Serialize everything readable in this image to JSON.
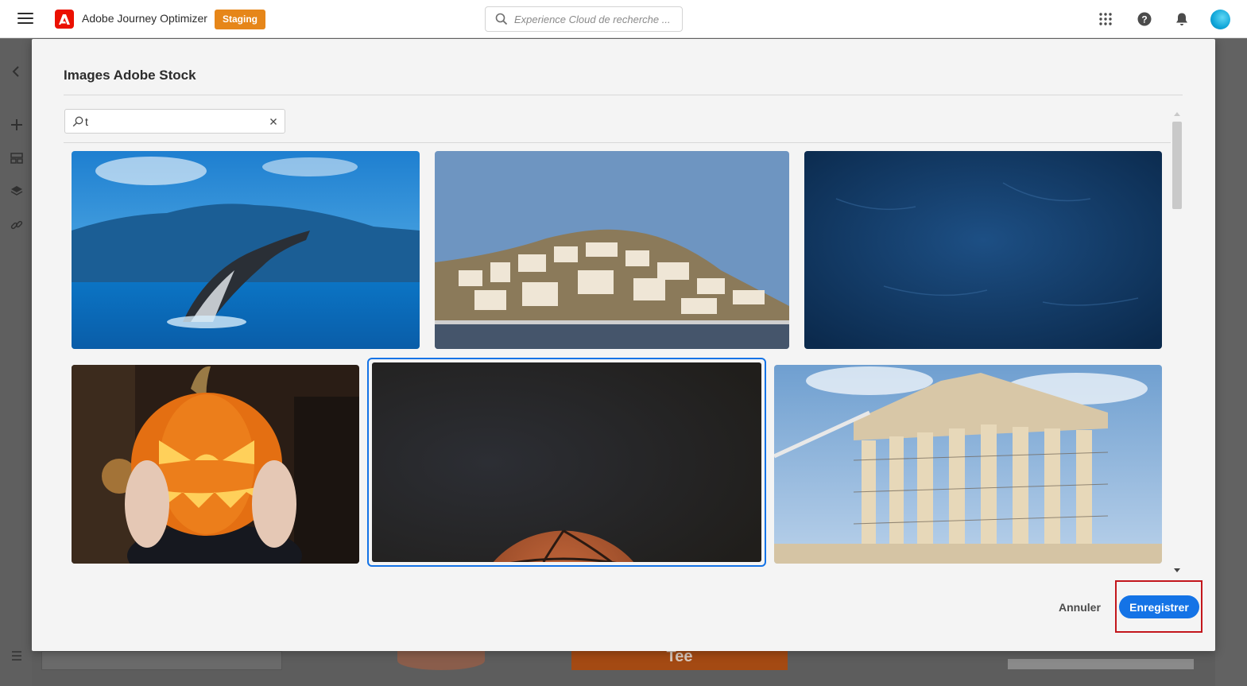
{
  "header": {
    "app_title": "Adobe Journey Optimizer",
    "environment_badge": "Staging",
    "search_placeholder": "Experience Cloud de recherche ..."
  },
  "modal": {
    "title": "Images Adobe Stock",
    "search_value": "t",
    "images": [
      {
        "subject": "humpback whale breaching at sea",
        "selected": false
      },
      {
        "subject": "hillside coastal town with harbor",
        "selected": false
      },
      {
        "subject": "dark blue textured background",
        "selected": false
      },
      {
        "subject": "carved halloween pumpkin held in hands",
        "selected": false
      },
      {
        "subject": "basketball on dark background",
        "selected": true
      },
      {
        "subject": "parthenon under scaffolding",
        "selected": false
      }
    ],
    "cancel_label": "Annuler",
    "save_label": "Enregistrer"
  },
  "background": {
    "banner_text": "Tee"
  },
  "colors": {
    "accent": "#1473e6",
    "badge": "#e68619",
    "brand": "#eb1000",
    "highlight": "#c3161c"
  }
}
